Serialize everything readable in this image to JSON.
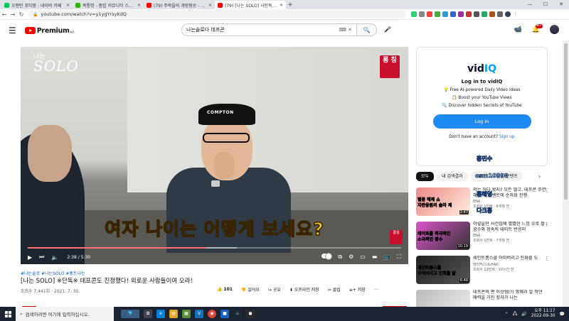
{
  "browser": {
    "tabs": [
      {
        "label": "오랜만 포티봉 : 네이버 카페",
        "color": "#03c75a",
        "active": false
      },
      {
        "label": "목통령 - 종합 커뮤니티 스토리 월",
        "color": "#2db400",
        "active": false
      },
      {
        "label": "(79) 주락을의 개방팡송 - YouTube",
        "color": "#ff0000",
        "active": false
      },
      {
        "label": "(79) [나는 SOLO] 사탄독※ 데프코",
        "color": "#ff0000",
        "active": true
      }
    ],
    "new_tab": "+",
    "url": "youtube.com/watch?v=y1ygYrsyKdQ"
  },
  "youtube": {
    "logo_text": "Premium",
    "logo_cc": "KR",
    "search_value": "나는솔로다 데프콘",
    "notifications_badge": "9+"
  },
  "video": {
    "show_small": "나는",
    "show_big": "SOLO",
    "stamp": "롱 칭",
    "stamp_small": "롱칭",
    "hat_text": "COMPTON",
    "subtitle": "여자 나이는 어떻게 보세요?",
    "time_current": "2:38",
    "time_total": "5:30",
    "time_display": "2:38 / 5:30",
    "progress_fraction": 0.479,
    "buffer_fraction": 0.56,
    "hashtags": "#나는솔로 #나는SOLO #홍트나는",
    "title": "[나는 SOLO] ※단독※ 데프콘도 진정했다! 외로운 사람들이여 오라!",
    "meta": "조회수 7,441회 · 2021. 7. 30.",
    "likes": "101",
    "dislike_label": "싫어요",
    "share_label": "공유",
    "offline_label": "오프라인 저장",
    "clip_label": "클립",
    "save_label": "저장"
  },
  "vidiq": {
    "logo_a": "vid",
    "logo_b": "IQ",
    "heading": "Log in to vidIQ",
    "features": [
      "💡 Free AI-powered Daily Video Ideas",
      "📋 Boost your YouTube Views",
      "🔍 Discover hidden Secrets of YouTube"
    ],
    "login_button": "Log in",
    "signup_prompt": "Don't have an account?",
    "signup_link": "Sign up"
  },
  "chips": [
    "모두",
    "내 검색결과",
    "SBS",
    "관련 콘텐츠"
  ],
  "overlay_names": [
    "홍민수",
    "osm10998",
    "홍혜영",
    "다크홍"
  ],
  "related": [
    {
      "title": "저는 어디 왔지? 모든 딸고. 데프콘 주연해 솔로 이벤트에 순차화 진행",
      "channel": "ENA",
      "meta": "조회수 1만회 · 6개월 전",
      "duration": "2:47",
      "cap1": "별종 해제 쇼",
      "cap2": "자판응원의 솔라 제",
      "colors": [
        "#e88",
        "#ffd"
      ]
    },
    {
      "title": "이렇을만 사건입에 별별한 느낌 오로 팔 : 광수와 정숙의 테이트 반응이",
      "channel": "ENA",
      "meta": "조회수 1만회 · 7개월 전",
      "duration": "10:19",
      "cap1": "데이트를 적극적인",
      "cap2": "소극적인 광수",
      "colors": [
        "#f4c",
        "#333"
      ]
    },
    {
      "title": "세인트폼스를 아이버리고 진화를 도",
      "channel": "엔터믹스ULHAK",
      "meta": "조회수 12만회 · 10시간 전",
      "duration": "6:48",
      "cap1": "세인트폼스를",
      "cap2": "아이버리고 진화를 밟",
      "colors": [
        "#222",
        "#444"
      ]
    },
    {
      "title": "데프콘의 편 이상형(?) 영혜과 알 작던 매력을 가진 정자가 나는",
      "channel": "ENA",
      "meta": "조회수 1만회",
      "duration": "",
      "cap1": "",
      "cap2": "",
      "colors": [
        "#bbb",
        "#ddd"
      ]
    }
  ],
  "taskbar": {
    "search_placeholder": "검색하려면 여기에 입력하십시오.",
    "time": "오후 11:17",
    "date": "2022-09-30"
  },
  "accent_colors": {
    "youtube_red": "#ff0000",
    "vidiq_blue": "#1f8bf2",
    "subtitle_yellow": "#f2c230"
  }
}
